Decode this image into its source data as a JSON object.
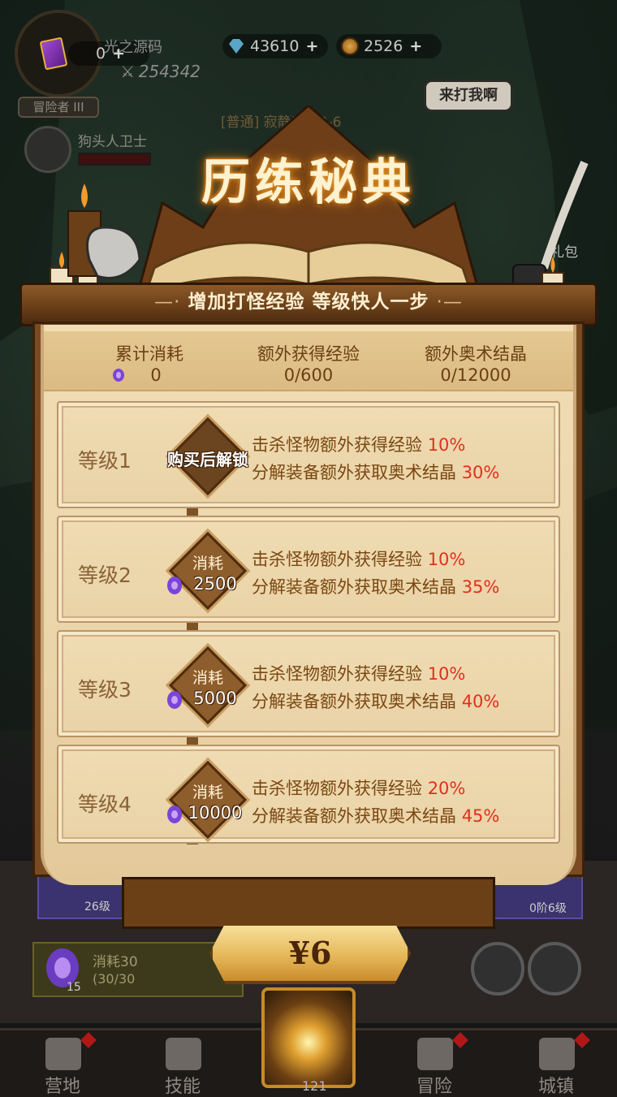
{
  "hud": {
    "cards": "0",
    "card_plus": "+",
    "player_name": "光之源码",
    "power": "254342",
    "gems": "43610",
    "gems_plus": "+",
    "coins": "2526",
    "coins_plus": "+",
    "rank": "冒险者 III",
    "enemy_name": "狗头人卫士",
    "stage": "[普通] 寂静森林3-6",
    "speech": "来打我啊",
    "side_gift": "礼包"
  },
  "panel": {
    "title": "历练秘典",
    "subtitle": "增加打怪经验 等级快人一步",
    "subtitle_deco_left": "—·",
    "subtitle_deco_right": "·—",
    "stats": [
      {
        "label": "累计消耗",
        "value": "0"
      },
      {
        "label": "额外获得经验",
        "value": "0/600"
      },
      {
        "label": "额外奥术结晶",
        "value": "0/12000"
      }
    ],
    "levels": [
      {
        "label": "等级1",
        "lock_text": "购买后解锁",
        "consume": "",
        "cost": "",
        "exp_text": "击杀怪物额外获得经验",
        "exp_pct": "10%",
        "crystal_text": "分解装备额外获取奥术结晶",
        "crystal_pct": "30%"
      },
      {
        "label": "等级2",
        "lock_text": "",
        "consume": "消耗",
        "cost": "2500",
        "exp_text": "击杀怪物额外获得经验",
        "exp_pct": "10%",
        "crystal_text": "分解装备额外获取奥术结晶",
        "crystal_pct": "35%"
      },
      {
        "label": "等级3",
        "lock_text": "",
        "consume": "消耗",
        "cost": "5000",
        "exp_text": "击杀怪物额外获得经验",
        "exp_pct": "10%",
        "crystal_text": "分解装备额外获取奥术结晶",
        "crystal_pct": "40%"
      },
      {
        "label": "等级4",
        "lock_text": "",
        "consume": "消耗",
        "cost": "10000",
        "exp_text": "击杀怪物额外获得经验",
        "exp_pct": "20%",
        "crystal_text": "分解装备额外获取奥术结晶",
        "crystal_pct": "45%"
      }
    ],
    "buy_label": "¥6"
  },
  "bottom": {
    "slot_lv_left": "26级",
    "slot_lv_right": "0阶6级",
    "consume_text": "消耗30",
    "consume_sub": "(30/30",
    "consume_count": "15",
    "center_count": "121",
    "nav": [
      "营地",
      "技能",
      "冒险",
      "城镇"
    ]
  },
  "colors": {
    "accent_gold": "#e5b859",
    "percent_red": "#e0301e",
    "parchment": "#ead4aa",
    "wood": "#7a4b22",
    "crystal_purple": "#8a4ee0"
  },
  "icons": [
    "card-icon",
    "gem-icon",
    "coin-icon",
    "sword-icon",
    "crystal-icon",
    "nav-camp-icon",
    "nav-skill-icon",
    "nav-adventure-icon",
    "nav-town-icon"
  ]
}
